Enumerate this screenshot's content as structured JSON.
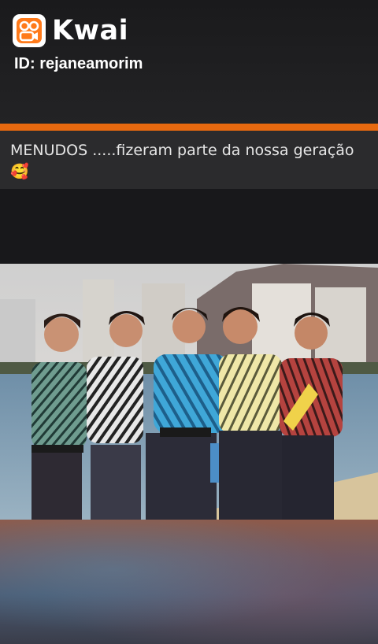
{
  "header": {
    "brand_name": "Kwai",
    "user_id": "ID: rejaneamorim",
    "logo_icon": "kwai-logo-icon",
    "accent_color": "#e8690f"
  },
  "post": {
    "caption": "MENUDOS .....fizeram parte da nossa geração 🥰"
  },
  "photo": {
    "icon": "group-photo"
  }
}
